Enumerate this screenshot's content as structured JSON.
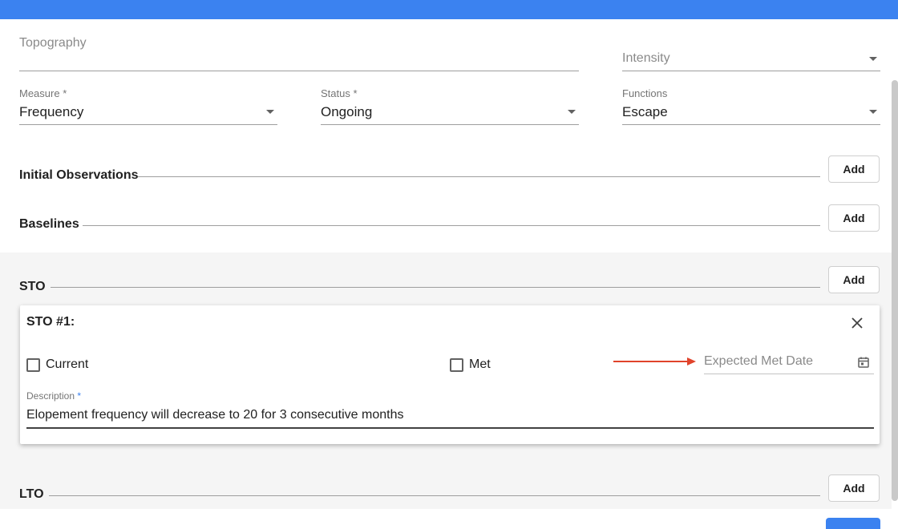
{
  "top_fields": {
    "topography": {
      "placeholder": "Topography"
    },
    "intensity": {
      "placeholder": "Intensity"
    }
  },
  "select_fields": {
    "measure": {
      "label": "Measure *",
      "value": "Frequency"
    },
    "status": {
      "label": "Status *",
      "value": "Ongoing"
    },
    "functions": {
      "label": "Functions",
      "value": "Escape"
    }
  },
  "sections": {
    "initial_observations": {
      "title": "Initial Observations",
      "add_label": "Add"
    },
    "baselines": {
      "title": "Baselines",
      "add_label": "Add"
    },
    "sto": {
      "title": "STO",
      "add_label": "Add"
    },
    "lto": {
      "title": "LTO",
      "add_label": "Add"
    }
  },
  "sto_card": {
    "title": "STO #1:",
    "current_label": "Current",
    "met_label": "Met",
    "expected_met_date_placeholder": "Expected Met Date",
    "description_label": "Description",
    "description_required": "*",
    "description_value": "Elopement frequency will decrease to 20 for 3 consecutive months",
    "close_icon": "close-icon",
    "calendar_icon": "calendar-icon"
  },
  "colors": {
    "topbar": "#3b82f0",
    "annotation_arrow": "#e0432b",
    "required_asterisk": "#3b82f0"
  }
}
